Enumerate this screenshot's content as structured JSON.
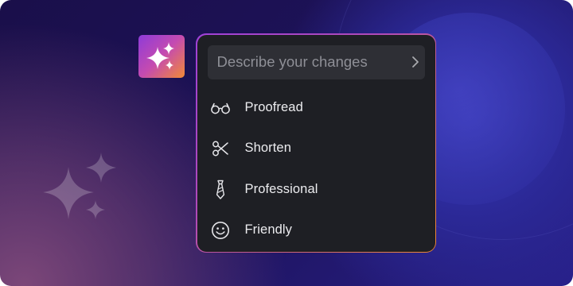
{
  "search": {
    "placeholder": "Describe your changes",
    "value": "",
    "submit_icon": "chevron-right-icon"
  },
  "ai_button": {
    "icon": "sparkles-icon"
  },
  "menu": {
    "items": [
      {
        "label": "Proofread",
        "icon": "glasses-icon"
      },
      {
        "label": "Shorten",
        "icon": "scissors-icon"
      },
      {
        "label": "Professional",
        "icon": "necktie-icon"
      },
      {
        "label": "Friendly",
        "icon": "smiley-icon"
      }
    ]
  },
  "colors": {
    "menu_background": "#1e1f24",
    "search_background": "#2e2f35",
    "border_gradient_start": "#a041d8",
    "border_gradient_end": "#f0892f",
    "text": "#ececef",
    "placeholder": "#8e8f96"
  }
}
